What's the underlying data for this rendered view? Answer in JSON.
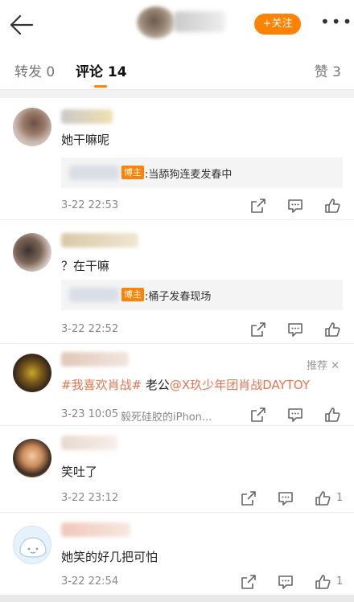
{
  "header": {
    "follow_label": "+关注",
    "more_label": "•••"
  },
  "tabs": {
    "repost": "转发 0",
    "comments": "评论 14",
    "likes": "赞 3"
  },
  "comments": [
    {
      "text": "她干嘛呢",
      "reply": {
        "badge": "博主",
        "text": ":当舔狗连麦发春中"
      },
      "time": "3-22 22:53",
      "like_count": ""
    },
    {
      "text": "？在干嘛",
      "reply": {
        "badge": "博主",
        "text": ":桶子发春现场"
      },
      "time": "3-22 22:52",
      "like_count": ""
    },
    {
      "hashtag": "#我喜欢肖战#",
      "text_mid": " 老公",
      "mention": "@X玖少年团肖战DAYTOY",
      "recommend": "推荐 ✕",
      "time": "3-23 10:05",
      "device": "毅死硅胶的iPhon...",
      "like_count": ""
    },
    {
      "text": "笑吐了",
      "time": "3-22 23:12",
      "like_count": "1"
    },
    {
      "text": "她笑的好几把可怕",
      "time": "3-22 22:54",
      "like_count": "1"
    }
  ],
  "icons": {
    "back": "back-arrow-icon",
    "share": "share-icon",
    "comment": "comment-icon",
    "like": "thumbs-up-icon"
  },
  "colors": {
    "accent": "#ff8200",
    "link": "#eb7350"
  }
}
